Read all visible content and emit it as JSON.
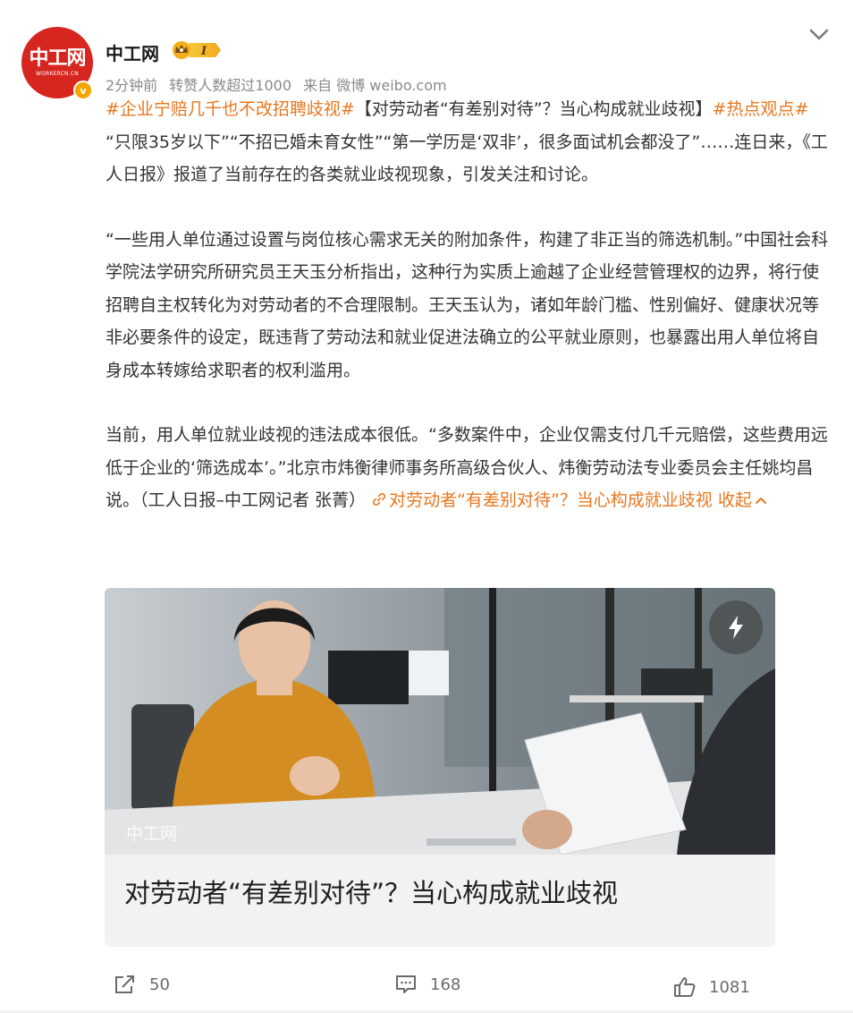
{
  "account": {
    "name": "中工网",
    "avatar_text": "中工网",
    "avatar_subtext": "WORKERCN.CN",
    "verified_mark": "v",
    "vip_level": "I"
  },
  "meta": {
    "time": "2分钟前",
    "reposts_note": "转赞人数超过1000",
    "source": "来自 微博 weibo.com"
  },
  "post": {
    "hashtag1": "#企业宁赔几千也不改招聘歧视#",
    "headline": "【对劳动者“有差别对待”？当心构成就业歧视】",
    "hashtag2": "#热点观点#",
    "para1": "“只限35岁以下”“不招已婚未育女性”“第一学历是‘双非’，很多面试机会都没了”……连日来，《工人日报》报道了当前存在的各类就业歧视现象，引发关注和讨论。",
    "para2": "“一些用人单位通过设置与岗位核心需求无关的附加条件，构建了非正当的筛选机制。”中国社会科学院法学研究所研究员王天玉分析指出，这种行为实质上逾越了企业经营管理权的边界，将行使招聘自主权转化为对劳动者的不合理限制。王天玉认为，诸如年龄门槛、性别偏好、健康状况等非必要条件的设定，既违背了劳动法和就业促进法确立的公平就业原则，也暴露出用人单位将自身成本转嫁给求职者的权利滥用。",
    "para3": "当前，用人单位就业歧视的违法成本很低。“多数案件中，企业仅需支付几千元赔偿，这些费用远低于企业的‘筛选成本’。”北京市炜衡律师事务所高级合伙人、炜衡劳动法专业委员会主任姚均昌说。（工人日报–中工网记者 张菁）",
    "link_text": "对劳动者“有差别对待”？当心构成就业歧视",
    "collapse_label": "收起"
  },
  "card": {
    "watermark": "中工网",
    "title": "对劳动者“有差别对待”？当心构成就业歧视"
  },
  "actions": {
    "share_count": "50",
    "comment_count": "168",
    "like_count": "1081"
  },
  "colors": {
    "accent": "#e8771f",
    "brand_red": "#d7261f",
    "text": "#333333",
    "meta": "#8a8a8a"
  }
}
